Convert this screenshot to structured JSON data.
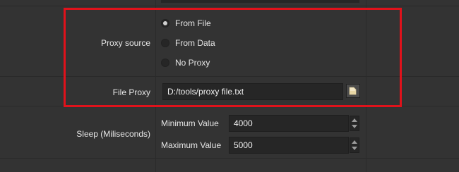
{
  "proxy": {
    "source_label": "Proxy source",
    "options": [
      "From File",
      "From Data",
      "No Proxy"
    ],
    "selected": "From File",
    "file_proxy_label": "File Proxy",
    "file_proxy_value": "D:/tools/proxy file.txt"
  },
  "sleep": {
    "label": "Sleep (Miliseconds)",
    "min_label": "Minimum Value",
    "min_value": "4000",
    "max_label": "Maximum Value",
    "max_value": "5000"
  },
  "colors": {
    "background": "#333333",
    "field": "#262626",
    "highlight_border": "#e0121b"
  },
  "icons": [
    "radio-selected-icon",
    "radio-icon",
    "folder-icon",
    "spin-up-icon",
    "spin-down-icon"
  ]
}
